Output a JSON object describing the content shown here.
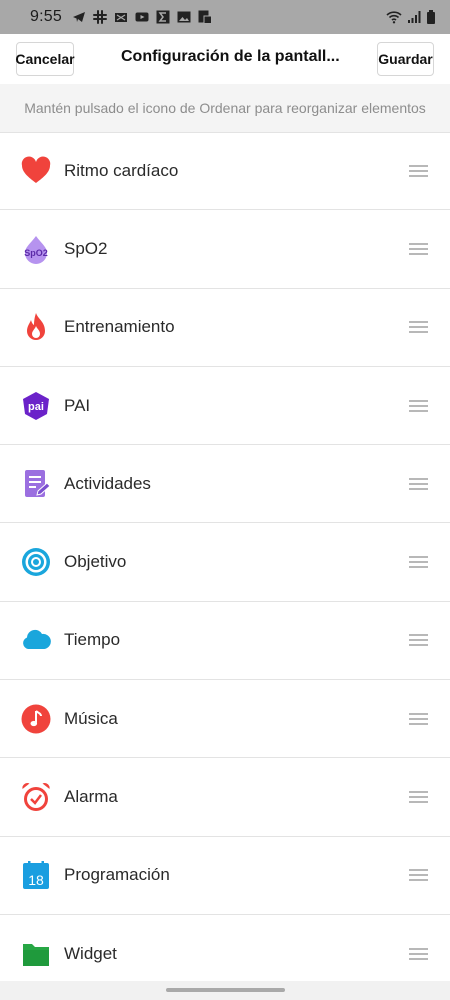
{
  "status_bar": {
    "time": "9:55",
    "left_icons": [
      "telegram-icon",
      "slack-icon",
      "mail-blocked-icon",
      "youtube-icon",
      "sigma-icon",
      "image-icon",
      "nfc-icon"
    ],
    "right_icons": [
      "wifi-icon",
      "signal-icon",
      "battery-icon"
    ]
  },
  "header": {
    "cancel_label": "Cancelar",
    "title": "Configuración de la pantall...",
    "save_label": "Guardar"
  },
  "hint": "Mantén pulsado el icono de Ordenar para reorganizar elementos",
  "items": [
    {
      "label": "Ritmo cardíaco",
      "icon": "heart-icon",
      "color": "#f0433c"
    },
    {
      "label": "SpO2",
      "icon": "spo2-icon",
      "icon_text": "SpO2",
      "color": "#9b6fe0"
    },
    {
      "label": "Entrenamiento",
      "icon": "flame-icon",
      "color": "#f0433c"
    },
    {
      "label": "PAI",
      "icon": "pai-icon",
      "icon_text": "pai",
      "color": "#6b22c9"
    },
    {
      "label": "Actividades",
      "icon": "activity-document-icon",
      "color": "#9b6fe0"
    },
    {
      "label": "Objetivo",
      "icon": "target-icon",
      "color": "#1aa6dc"
    },
    {
      "label": "Tiempo",
      "icon": "cloud-icon",
      "color": "#1aa6dc"
    },
    {
      "label": "Música",
      "icon": "music-note-icon",
      "color": "#f0433c"
    },
    {
      "label": "Alarma",
      "icon": "alarm-clock-icon",
      "color": "#f0433c"
    },
    {
      "label": "Programación",
      "icon": "calendar-icon",
      "icon_text": "18",
      "color": "#1a9ee0"
    },
    {
      "label": "Widget",
      "icon": "folder-icon",
      "color": "#27a745"
    }
  ]
}
